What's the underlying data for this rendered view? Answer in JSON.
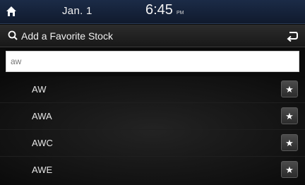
{
  "status_bar": {
    "date": "Jan.  1",
    "time": "6:45",
    "ampm": "PM",
    "home_icon": "home-icon"
  },
  "header": {
    "title": "Add a Favorite Stock",
    "search_icon": "search-icon",
    "back_icon": "back-arrow-icon"
  },
  "search": {
    "value": "aw"
  },
  "results": [
    {
      "symbol": "AW",
      "favorite_icon": "star-icon"
    },
    {
      "symbol": "AWA",
      "favorite_icon": "star-icon"
    },
    {
      "symbol": "AWC",
      "favorite_icon": "star-icon"
    },
    {
      "symbol": "AWE",
      "favorite_icon": "star-icon"
    }
  ]
}
